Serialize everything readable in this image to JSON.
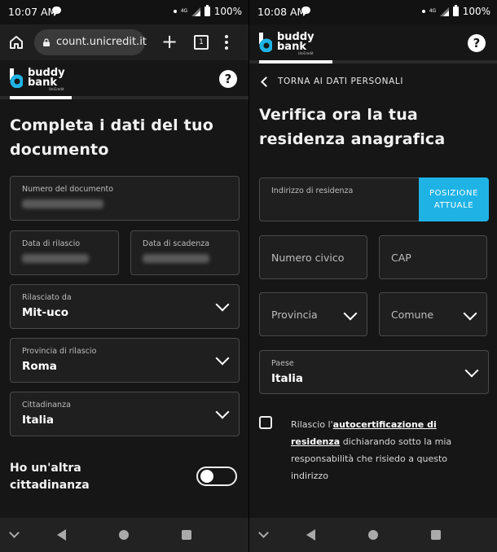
{
  "left": {
    "status": {
      "time": "10:07 AM",
      "net": "4G",
      "battery": "100%"
    },
    "browser": {
      "url": "count.unicredit.it",
      "tab_count": "1"
    },
    "brand": {
      "line1": "buddy",
      "line2": "bank",
      "sub": "UniCredit"
    },
    "progress": 0.27,
    "title": "Completa i dati del tuo documento",
    "fields": {
      "doc_number_label": "Numero del documento",
      "issue_date_label": "Data di rilascio",
      "expiry_date_label": "Data di scadenza",
      "issued_by_label": "Rilasciato da",
      "issued_by_value": "Mit-uco",
      "province_label": "Provincia di rilascio",
      "province_value": "Roma",
      "citizenship_label": "Cittadinanza",
      "citizenship_value": "Italia"
    },
    "toggle_label": "Ho un'altra cittadinanza",
    "toggle_on": false
  },
  "right": {
    "status": {
      "time": "10:08 AM",
      "net": "4G",
      "battery": "100%"
    },
    "brand": {
      "line1": "buddy",
      "line2": "bank",
      "sub": "UniCredit"
    },
    "progress": 0.32,
    "back_label": "TORNA AI DATI PERSONALI",
    "title": "Verifica ora la tua residenza anagrafica",
    "fields": {
      "address_label": "Indirizzo di residenza",
      "position_button": "POSIZIONE ATTUALE",
      "civic_placeholder": "Numero civico",
      "cap_placeholder": "CAP",
      "province_placeholder": "Provincia",
      "comune_placeholder": "Comune",
      "country_label": "Paese",
      "country_value": "Italia"
    },
    "checkbox": {
      "prefix": "Rilascio l'",
      "link": "autocertificazione di residenza",
      "suffix": " dichiarando sotto la mia responsabilità che risiedo a questo indirizzo",
      "checked": false
    }
  }
}
